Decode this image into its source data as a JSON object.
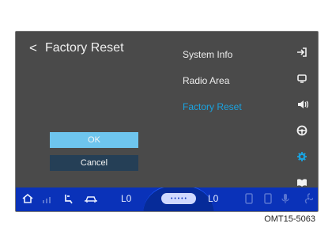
{
  "screen": {
    "back_label": "<",
    "title": "Factory Reset"
  },
  "menu": {
    "items": [
      {
        "label": "System Info"
      },
      {
        "label": "Radio Area"
      },
      {
        "label": "Factory Reset"
      }
    ]
  },
  "dialog": {
    "ok_label": "OK",
    "cancel_label": "Cancel"
  },
  "statusbar": {
    "left_level": "L0",
    "right_level": "L0",
    "center_pill": "• • • • •"
  },
  "caption": "OMT15-5063",
  "colors": {
    "accent": "#1aa3e0",
    "panel": "#4a4a4a",
    "statusbar": "#0a32b9"
  },
  "icons": {
    "side": [
      "exit-icon",
      "monitor-icon",
      "speaker-icon",
      "steering-wheel-icon",
      "gear-icon",
      "book-icon"
    ],
    "bar": [
      "home-icon",
      "signal-icon",
      "seat-icon",
      "car-icon",
      "phone-icon",
      "phone-icon",
      "mic-icon",
      "fan-icon"
    ]
  }
}
